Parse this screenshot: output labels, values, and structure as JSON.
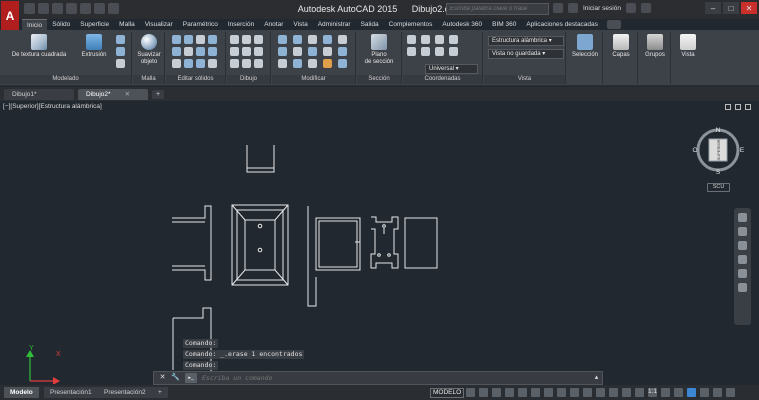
{
  "titlebar": {
    "app_title": "Autodesk AutoCAD 2015",
    "file_title": "Dibujo2.dwg",
    "search_placeholder": "Escriba palabra clave o frase",
    "login_label": "Iniciar sesión",
    "logo_letter": "A"
  },
  "ribbon_tabs": [
    "Inicio",
    "Sólido",
    "Superficie",
    "Malla",
    "Visualizar",
    "Paramétrico",
    "Inserción",
    "Anotar",
    "Vista",
    "Administrar",
    "Salida",
    "Complementos",
    "Autodesk 360",
    "BIM 360",
    "Aplicaciones destacadas"
  ],
  "ribbon": {
    "modelado_label": "Modelado",
    "textura_btn": "De textura cuadrada",
    "extrusion_btn": "Extrusión",
    "suavizar_line1": "Suavizar",
    "suavizar_line2": "objeto",
    "malla_label": "Malla",
    "editar_solidos_label": "Editar sólidos",
    "dibujo_label": "Dibujo",
    "modificar_label": "Modificar",
    "plano_line1": "Plano",
    "plano_line2": "de sección",
    "seccion_label": "Sección",
    "coordenadas_label": "Coordenadas",
    "visual_style": "Estructura alámbrica",
    "view_state": "Vista no guardada",
    "ucs_value": "Universal",
    "vista_label": "Vista",
    "seleccion_btn": "Selección",
    "capas_btn": "Capas",
    "grupos_btn": "Grupos",
    "vista_btn": "Vista"
  },
  "doc_tabs": [
    {
      "label": "Dibujo1*",
      "active": false
    },
    {
      "label": "Dibujo2*",
      "active": true
    }
  ],
  "doc_plus": "+",
  "viewport_label": "[−][Superior][Estructura alámbrica]",
  "viewcube": {
    "n": "N",
    "s": "S",
    "e": "E",
    "o": "O",
    "face": "SUPERIOR"
  },
  "scu_label": "SCU",
  "command_history": [
    "Comando:",
    "Comando:  _.erase 1 encontrados",
    "Comando:"
  ],
  "command_placeholder": "Escriba un comando",
  "status": {
    "layout_tabs": [
      "Modelo",
      "Presentación1",
      "Presentación2"
    ],
    "plus": "+",
    "model_label": "MODELO",
    "scale_label": "1:1"
  },
  "ucs_axes": {
    "x": "X",
    "y": "Y"
  }
}
